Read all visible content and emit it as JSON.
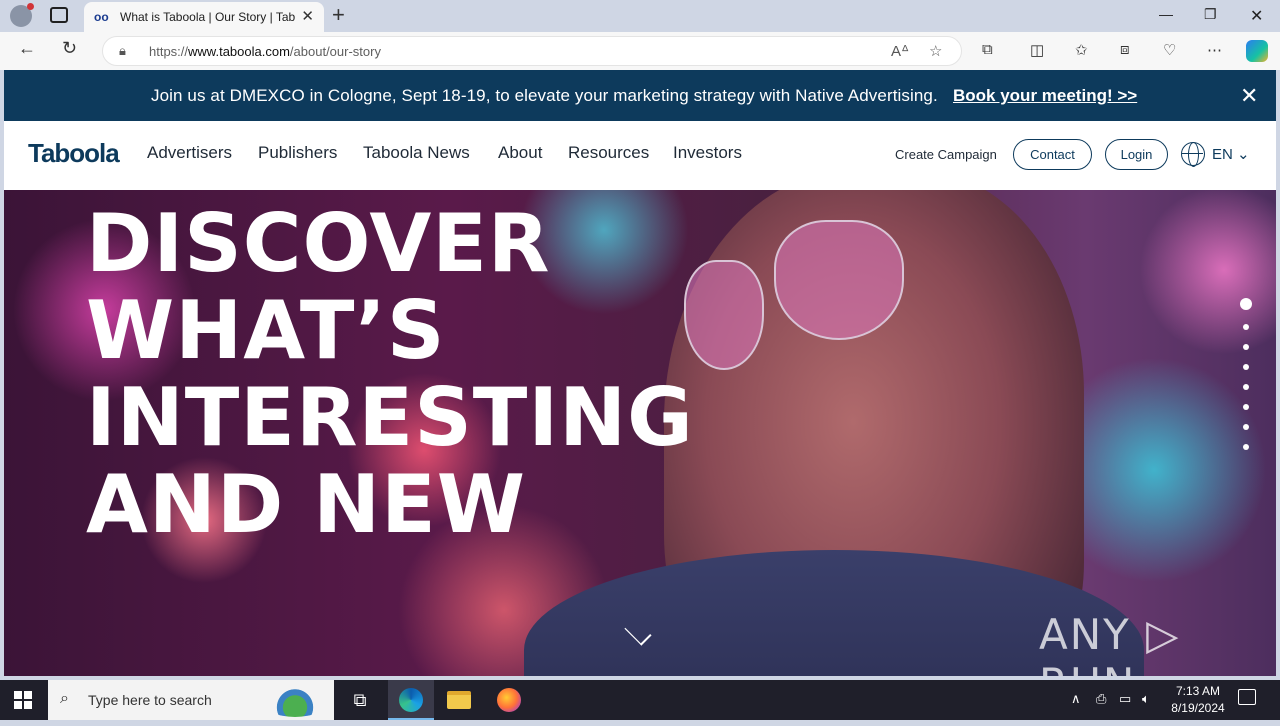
{
  "browser": {
    "tab_title": "What is Taboola | Our Story | Taboola",
    "tab_favicon": "oo",
    "url_prefix": "https://",
    "url_domain": "www.taboola.com",
    "url_path": "/about/our-story"
  },
  "promo": {
    "text": "Join us at DMEXCO in Cologne, Sept 18-19, to elevate your marketing strategy with Native Advertising.",
    "link": "Book your meeting! >>"
  },
  "nav": {
    "logo": "Taboola",
    "items": [
      "Advertisers",
      "Publishers",
      "Taboola News",
      "About",
      "Resources",
      "Investors"
    ],
    "create_campaign": "Create Campaign",
    "contact": "Contact",
    "login": "Login",
    "language": "EN"
  },
  "hero": {
    "lines": [
      "DISCOVER",
      "WHAT’S",
      "INTERESTING",
      "AND NEW"
    ],
    "slide_count": 8,
    "active_slide": 1,
    "watermark": "ANY ▷ RUN"
  },
  "taskbar": {
    "search_placeholder": "Type here to search",
    "time": "7:13 AM",
    "date": "8/19/2024"
  },
  "colors": {
    "brand_navy": "#0d3a5c",
    "taskbar": "#1f1f2a"
  }
}
